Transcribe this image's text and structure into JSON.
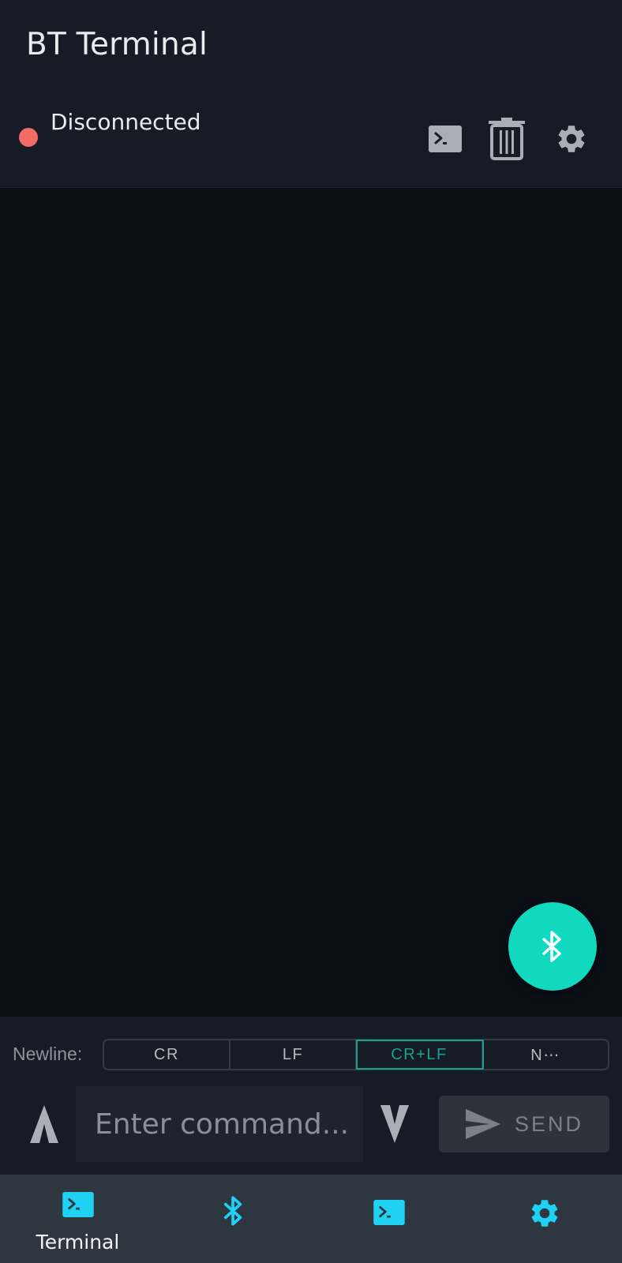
{
  "header": {
    "title": "BT Terminal",
    "status_text": "Disconnected",
    "status_color": "#f26b67"
  },
  "toolbar": {
    "icons": [
      "terminal-icon",
      "trash-icon",
      "gear-icon"
    ]
  },
  "fab": {
    "icon": "bluetooth-icon",
    "color": "#10d9c0"
  },
  "newline": {
    "label": "Newline:",
    "options": [
      "CR",
      "LF",
      "CR+LF",
      "N⋯"
    ],
    "selected": "CR+LF"
  },
  "command": {
    "placeholder": "Enter command...",
    "value": ""
  },
  "send": {
    "label": "SEND"
  },
  "nav": {
    "accent": "#1fd1f2",
    "items": [
      {
        "icon": "terminal-icon",
        "label": "Terminal"
      },
      {
        "icon": "bluetooth-icon",
        "label": ""
      },
      {
        "icon": "terminal-icon",
        "label": ""
      },
      {
        "icon": "gear-icon",
        "label": ""
      }
    ]
  }
}
